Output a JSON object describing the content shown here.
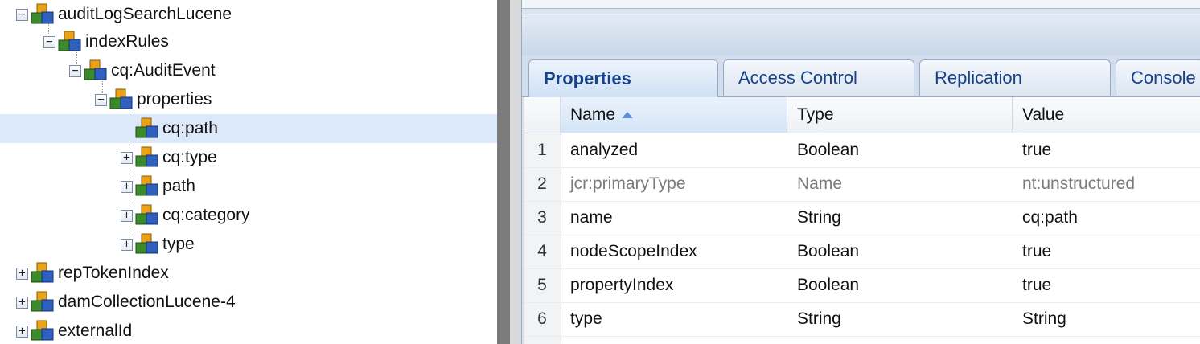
{
  "tree": {
    "nodes": [
      {
        "label": "auditLogSearchLucene",
        "toggle": "⊟",
        "expanded": true,
        "depth": 0
      },
      {
        "label": "indexRules",
        "toggle": "⊟",
        "expanded": true,
        "depth": 1
      },
      {
        "label": "cq:AuditEvent",
        "toggle": "⊟",
        "expanded": true,
        "depth": 2
      },
      {
        "label": "properties",
        "toggle": "⊟",
        "expanded": true,
        "depth": 3
      },
      {
        "label": "cq:path",
        "toggle": "",
        "expanded": false,
        "depth": 4,
        "selected": true
      },
      {
        "label": "cq:type",
        "toggle": "⊞",
        "expanded": false,
        "depth": 4
      },
      {
        "label": "path",
        "toggle": "⊞",
        "expanded": false,
        "depth": 4
      },
      {
        "label": "cq:category",
        "toggle": "⊞",
        "expanded": false,
        "depth": 4
      },
      {
        "label": "type",
        "toggle": "⊞",
        "expanded": false,
        "depth": 4
      },
      {
        "label": "repTokenIndex",
        "toggle": "⊞",
        "expanded": false,
        "depth": 0
      },
      {
        "label": "damCollectionLucene-4",
        "toggle": "⊞",
        "expanded": false,
        "depth": 0
      },
      {
        "label": "externalId",
        "toggle": "⊞",
        "expanded": false,
        "depth": 0
      }
    ],
    "node_icon": "node-cubes-icon"
  },
  "tabs": [
    {
      "label": "Properties",
      "active": true
    },
    {
      "label": "Access Control",
      "active": false
    },
    {
      "label": "Replication",
      "active": false
    },
    {
      "label": "Console",
      "active": false
    }
  ],
  "grid": {
    "columns": {
      "name": "Name",
      "type": "Type",
      "value": "Value"
    },
    "sort_icon": "sort-ascending-icon",
    "rows": [
      {
        "num": "1",
        "name": "analyzed",
        "type": "Boolean",
        "value": "true",
        "protected": false
      },
      {
        "num": "2",
        "name": "jcr:primaryType",
        "type": "Name",
        "value": "nt:unstructured",
        "protected": true
      },
      {
        "num": "3",
        "name": "name",
        "type": "String",
        "value": "cq:path",
        "protected": false
      },
      {
        "num": "4",
        "name": "nodeScopeIndex",
        "type": "Boolean",
        "value": "true",
        "protected": false
      },
      {
        "num": "5",
        "name": "propertyIndex",
        "type": "Boolean",
        "value": "true",
        "protected": false
      },
      {
        "num": "6",
        "name": "type",
        "type": "String",
        "value": "String",
        "protected": false
      }
    ]
  },
  "colors": {
    "selection": "#dbe9fb",
    "tab_text": "#15428b",
    "splitter": "#7b7b7b"
  }
}
